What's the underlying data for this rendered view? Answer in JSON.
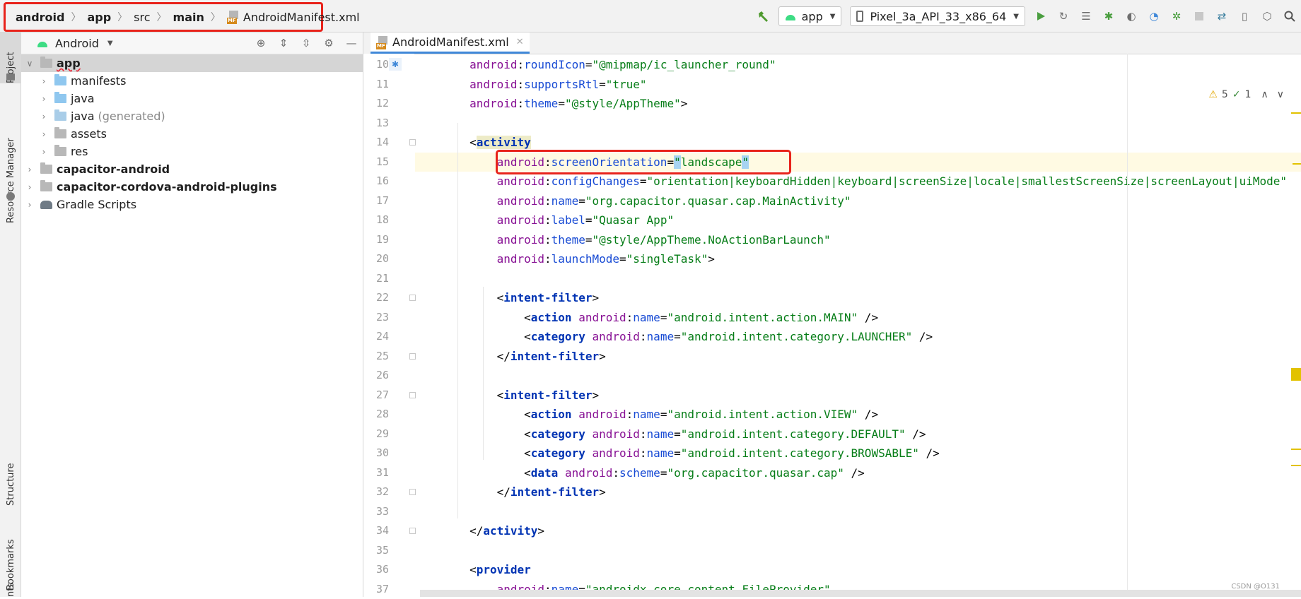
{
  "breadcrumb": {
    "items": [
      {
        "label": "android",
        "bold": true
      },
      {
        "label": "app",
        "bold": true
      },
      {
        "label": "src",
        "bold": false
      },
      {
        "label": "main",
        "bold": true
      }
    ],
    "file_badge": "MF",
    "file": "AndroidManifest.xml"
  },
  "toolbar": {
    "run_config": "app",
    "device": "Pixel_3a_API_33_x86_64"
  },
  "left_strip": {
    "project": "Project",
    "resource_manager": "Resource Manager",
    "structure": "Structure",
    "bookmarks": "Bookmarks",
    "bottom_cut": "nts",
    "top_cut": "IJ"
  },
  "project_panel": {
    "view": "Android",
    "tree": [
      {
        "label": "app",
        "extra": "",
        "level": 0,
        "expanded": true,
        "bold": true,
        "selected": true,
        "icon": "module-folder"
      },
      {
        "label": "manifests",
        "extra": "",
        "level": 1,
        "expanded": false,
        "bold": false,
        "icon": "folder"
      },
      {
        "label": "java",
        "extra": "",
        "level": 1,
        "expanded": false,
        "bold": false,
        "icon": "folder"
      },
      {
        "label": "java",
        "extra": "(generated)",
        "level": 1,
        "expanded": false,
        "bold": false,
        "icon": "generated-folder"
      },
      {
        "label": "assets",
        "extra": "",
        "level": 1,
        "expanded": false,
        "bold": false,
        "icon": "resource-folder"
      },
      {
        "label": "res",
        "extra": "",
        "level": 1,
        "expanded": false,
        "bold": false,
        "icon": "resource-folder"
      },
      {
        "label": "capacitor-android",
        "extra": "",
        "level": 0,
        "expanded": false,
        "bold": true,
        "icon": "library-folder"
      },
      {
        "label": "capacitor-cordova-android-plugins",
        "extra": "",
        "level": 0,
        "expanded": false,
        "bold": true,
        "icon": "library-folder"
      },
      {
        "label": "Gradle Scripts",
        "extra": "",
        "level": 0,
        "expanded": false,
        "bold": false,
        "icon": "gradle-icon"
      }
    ]
  },
  "editor": {
    "tab_badge": "MF",
    "tab": "AndroidManifest.xml",
    "warnings": "5",
    "weak_warnings": "1",
    "current_line": 15,
    "lines": [
      {
        "n": "10",
        "tokens": [
          [
            "pl",
            "        "
          ],
          [
            "ns",
            "android"
          ],
          [
            "pl",
            ":"
          ],
          [
            "at",
            "roundIcon"
          ],
          [
            "pl",
            "="
          ],
          [
            "sv",
            "\"@mipmap/ic_launcher_round\""
          ]
        ]
      },
      {
        "n": "11",
        "tokens": [
          [
            "pl",
            "        "
          ],
          [
            "ns",
            "android"
          ],
          [
            "pl",
            ":"
          ],
          [
            "at",
            "supportsRtl"
          ],
          [
            "pl",
            "="
          ],
          [
            "sv",
            "\"true\""
          ]
        ]
      },
      {
        "n": "12",
        "tokens": [
          [
            "pl",
            "        "
          ],
          [
            "ns",
            "android"
          ],
          [
            "pl",
            ":"
          ],
          [
            "at",
            "theme"
          ],
          [
            "pl",
            "="
          ],
          [
            "sv",
            "\"@style/AppTheme\""
          ],
          [
            "br",
            ">"
          ]
        ]
      },
      {
        "n": "13",
        "tokens": []
      },
      {
        "n": "14",
        "tokens": [
          [
            "pl",
            "        "
          ],
          [
            "br",
            "<"
          ],
          [
            "tg hl-tag",
            "activity"
          ]
        ]
      },
      {
        "n": "15",
        "tokens": [
          [
            "pl",
            "            "
          ],
          [
            "ns",
            "android"
          ],
          [
            "pl",
            ":"
          ],
          [
            "at",
            "screenOrientation"
          ],
          [
            "pl",
            "="
          ],
          [
            "sv qhl",
            "\""
          ],
          [
            "sv",
            "landscape"
          ],
          [
            "sv qhl",
            "\""
          ]
        ]
      },
      {
        "n": "16",
        "tokens": [
          [
            "pl",
            "            "
          ],
          [
            "ns",
            "android"
          ],
          [
            "pl",
            ":"
          ],
          [
            "at",
            "configChanges"
          ],
          [
            "pl",
            "="
          ],
          [
            "sv",
            "\"orientation|keyboardHidden|keyboard|screenSize|locale|smallestScreenSize|screenLayout|uiMode\""
          ]
        ]
      },
      {
        "n": "17",
        "tokens": [
          [
            "pl",
            "            "
          ],
          [
            "ns",
            "android"
          ],
          [
            "pl",
            ":"
          ],
          [
            "at",
            "name"
          ],
          [
            "pl",
            "="
          ],
          [
            "sv",
            "\"org.capacitor.quasar.cap.MainActivity\""
          ]
        ]
      },
      {
        "n": "18",
        "tokens": [
          [
            "pl",
            "            "
          ],
          [
            "ns",
            "android"
          ],
          [
            "pl",
            ":"
          ],
          [
            "at",
            "label"
          ],
          [
            "pl",
            "="
          ],
          [
            "sv",
            "\"Quasar App\""
          ]
        ]
      },
      {
        "n": "19",
        "tokens": [
          [
            "pl",
            "            "
          ],
          [
            "ns",
            "android"
          ],
          [
            "pl",
            ":"
          ],
          [
            "at",
            "theme"
          ],
          [
            "pl",
            "="
          ],
          [
            "sv",
            "\"@style/AppTheme.NoActionBarLaunch\""
          ]
        ]
      },
      {
        "n": "20",
        "tokens": [
          [
            "pl",
            "            "
          ],
          [
            "ns",
            "android"
          ],
          [
            "pl",
            ":"
          ],
          [
            "at",
            "launchMode"
          ],
          [
            "pl",
            "="
          ],
          [
            "sv",
            "\"singleTask\""
          ],
          [
            "br",
            ">"
          ]
        ]
      },
      {
        "n": "21",
        "tokens": []
      },
      {
        "n": "22",
        "tokens": [
          [
            "pl",
            "            "
          ],
          [
            "br",
            "<"
          ],
          [
            "tg",
            "intent-filter"
          ],
          [
            "br",
            ">"
          ]
        ]
      },
      {
        "n": "23",
        "tokens": [
          [
            "pl",
            "                "
          ],
          [
            "br",
            "<"
          ],
          [
            "tg",
            "action "
          ],
          [
            "ns",
            "android"
          ],
          [
            "pl",
            ":"
          ],
          [
            "at",
            "name"
          ],
          [
            "pl",
            "="
          ],
          [
            "sv",
            "\"android.intent.action.MAIN\""
          ],
          [
            "br",
            " />"
          ]
        ]
      },
      {
        "n": "24",
        "tokens": [
          [
            "pl",
            "                "
          ],
          [
            "br",
            "<"
          ],
          [
            "tg",
            "category "
          ],
          [
            "ns",
            "android"
          ],
          [
            "pl",
            ":"
          ],
          [
            "at",
            "name"
          ],
          [
            "pl",
            "="
          ],
          [
            "sv",
            "\"android.intent.category.LAUNCHER\""
          ],
          [
            "br",
            " />"
          ]
        ]
      },
      {
        "n": "25",
        "tokens": [
          [
            "pl",
            "            "
          ],
          [
            "br",
            "</"
          ],
          [
            "tg",
            "intent-filter"
          ],
          [
            "br",
            ">"
          ]
        ]
      },
      {
        "n": "26",
        "tokens": []
      },
      {
        "n": "27",
        "tokens": [
          [
            "pl",
            "            "
          ],
          [
            "br",
            "<"
          ],
          [
            "tg",
            "intent-filter"
          ],
          [
            "br",
            ">"
          ]
        ]
      },
      {
        "n": "28",
        "tokens": [
          [
            "pl",
            "                "
          ],
          [
            "br",
            "<"
          ],
          [
            "tg",
            "action "
          ],
          [
            "ns",
            "android"
          ],
          [
            "pl",
            ":"
          ],
          [
            "at",
            "name"
          ],
          [
            "pl",
            "="
          ],
          [
            "sv",
            "\"android.intent.action.VIEW\""
          ],
          [
            "br",
            " />"
          ]
        ]
      },
      {
        "n": "29",
        "tokens": [
          [
            "pl",
            "                "
          ],
          [
            "br",
            "<"
          ],
          [
            "tg",
            "category "
          ],
          [
            "ns",
            "android"
          ],
          [
            "pl",
            ":"
          ],
          [
            "at",
            "name"
          ],
          [
            "pl",
            "="
          ],
          [
            "sv",
            "\"android.intent.category.DEFAULT\""
          ],
          [
            "br",
            " />"
          ]
        ]
      },
      {
        "n": "30",
        "tokens": [
          [
            "pl",
            "                "
          ],
          [
            "br",
            "<"
          ],
          [
            "tg",
            "category "
          ],
          [
            "ns",
            "android"
          ],
          [
            "pl",
            ":"
          ],
          [
            "at",
            "name"
          ],
          [
            "pl",
            "="
          ],
          [
            "sv",
            "\"android.intent.category.BROWSABLE\""
          ],
          [
            "br",
            " />"
          ]
        ]
      },
      {
        "n": "31",
        "tokens": [
          [
            "pl",
            "                "
          ],
          [
            "br",
            "<"
          ],
          [
            "tg",
            "data "
          ],
          [
            "ns",
            "android"
          ],
          [
            "pl",
            ":"
          ],
          [
            "at",
            "scheme"
          ],
          [
            "pl",
            "="
          ],
          [
            "sv",
            "\"org.capacitor.quasar.cap\""
          ],
          [
            "br",
            " />"
          ]
        ]
      },
      {
        "n": "32",
        "tokens": [
          [
            "pl",
            "            "
          ],
          [
            "br",
            "</"
          ],
          [
            "tg",
            "intent-filter"
          ],
          [
            "br",
            ">"
          ]
        ]
      },
      {
        "n": "33",
        "tokens": []
      },
      {
        "n": "34",
        "tokens": [
          [
            "pl",
            "        "
          ],
          [
            "br",
            "</"
          ],
          [
            "tg",
            "activity"
          ],
          [
            "br",
            ">"
          ]
        ]
      },
      {
        "n": "35",
        "tokens": []
      },
      {
        "n": "36",
        "tokens": [
          [
            "pl",
            "        "
          ],
          [
            "br",
            "<"
          ],
          [
            "tg",
            "provider"
          ]
        ]
      },
      {
        "n": "37",
        "tokens": [
          [
            "pl",
            "            "
          ],
          [
            "ns",
            "android"
          ],
          [
            "pl",
            ":"
          ],
          [
            "at",
            "name"
          ],
          [
            "pl",
            "="
          ],
          [
            "sv",
            "\"androidx.core.content.FileProvider\""
          ]
        ]
      }
    ]
  },
  "watermark": "CSDN @O131",
  "colors": {
    "highlight_border": "#e8231b",
    "android_green": "#3ddc84",
    "string": "#067d17",
    "namespace": "#871094",
    "attribute": "#174ad4",
    "tag": "#0033b3"
  }
}
